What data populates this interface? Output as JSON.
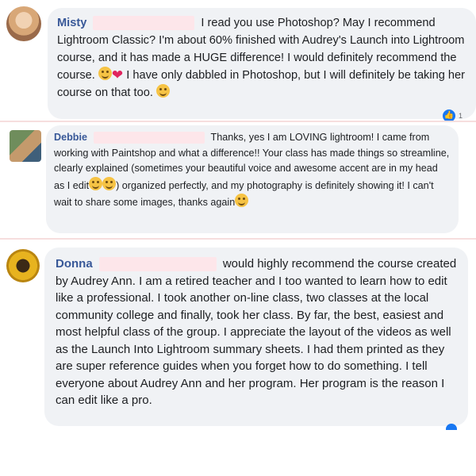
{
  "comments": [
    {
      "name": "Misty",
      "text_part1": "I read you use Photoshop? May I recommend Lightroom Classic? I'm about 60% finished with Audrey's Launch into Lightroom course, and it has made a HUGE difference! I would definitely recommend the course.",
      "text_part2": "I have only dabbled in Photoshop, but I will definitely be taking her course on that too.",
      "reaction_count": "1"
    },
    {
      "name": "Debbie",
      "text_part1": "Thanks, yes I am LOVING lightroom! I came from working with Paintshop and what a difference!! Your class has made things so streamline, clearly explained (sometimes your beautiful voice and awesome accent are in my head as I edit",
      "text_part2": ") organized perfectly, and my photography is definitely showing it! I can't wait to share some images, thanks again"
    },
    {
      "name": "Donna",
      "text": "would highly recommend the course created by Audrey Ann. I am a retired teacher and I too wanted to learn how to edit like a professional. I took another on-line class, two classes at the local community college and finally, took her class. By far, the best, easiest and most helpful class of the group. I appreciate the layout of the videos as well as the Launch Into Lightroom summary sheets. I had them printed as they are super reference guides when you forget how to do something. I tell everyone about Audrey Ann and her program. Her program is the reason I can edit like a pro."
    }
  ],
  "icons": [
    "smile-emoji-icon",
    "heart-icon",
    "like-icon"
  ],
  "colors": {
    "name": "#385898",
    "bubble": "#f0f2f5",
    "redaction": "#fde6ea",
    "like": "#1877f2"
  }
}
